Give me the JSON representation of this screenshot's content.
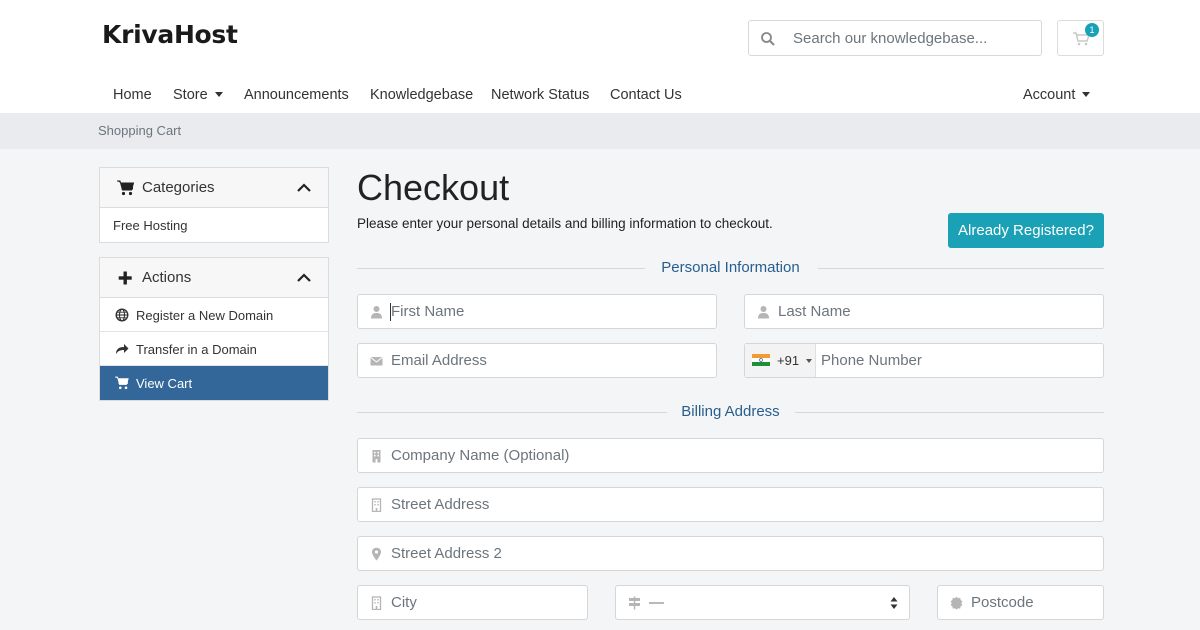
{
  "brand": {
    "logo": "KrivaHost"
  },
  "header": {
    "search_placeholder": "Search our knowledgebase...",
    "cart_count": "1"
  },
  "nav": {
    "items": [
      {
        "label": "Home"
      },
      {
        "label": "Store"
      },
      {
        "label": "Announcements"
      },
      {
        "label": "Knowledgebase"
      },
      {
        "label": "Network Status"
      },
      {
        "label": "Contact Us"
      }
    ],
    "account": "Account"
  },
  "breadcrumb": "Shopping Cart",
  "sidebar": {
    "categories": {
      "title": "Categories",
      "items": [
        "Free Hosting"
      ]
    },
    "actions": {
      "title": "Actions",
      "items": [
        {
          "label": "Register a New Domain",
          "icon": "globe-icon"
        },
        {
          "label": "Transfer in a Domain",
          "icon": "share-icon"
        },
        {
          "label": "View Cart",
          "icon": "cart-icon",
          "active": true
        }
      ]
    }
  },
  "main": {
    "title": "Checkout",
    "subtitle": "Please enter your personal details and billing information to checkout.",
    "registered_button": "Already Registered?",
    "personal_section": "Personal Information",
    "billing_section": "Billing Address",
    "fields": {
      "first_name": "First Name",
      "last_name": "Last Name",
      "email": "Email Address",
      "phone_code": "+91",
      "phone": "Phone Number",
      "company": "Company Name (Optional)",
      "street": "Street Address",
      "street2": "Street Address 2",
      "city": "City",
      "state": "—",
      "postcode": "Postcode"
    }
  },
  "colors": {
    "accent": "#1aa1b6",
    "active_nav": "#336699",
    "section_label": "#285e8e"
  }
}
